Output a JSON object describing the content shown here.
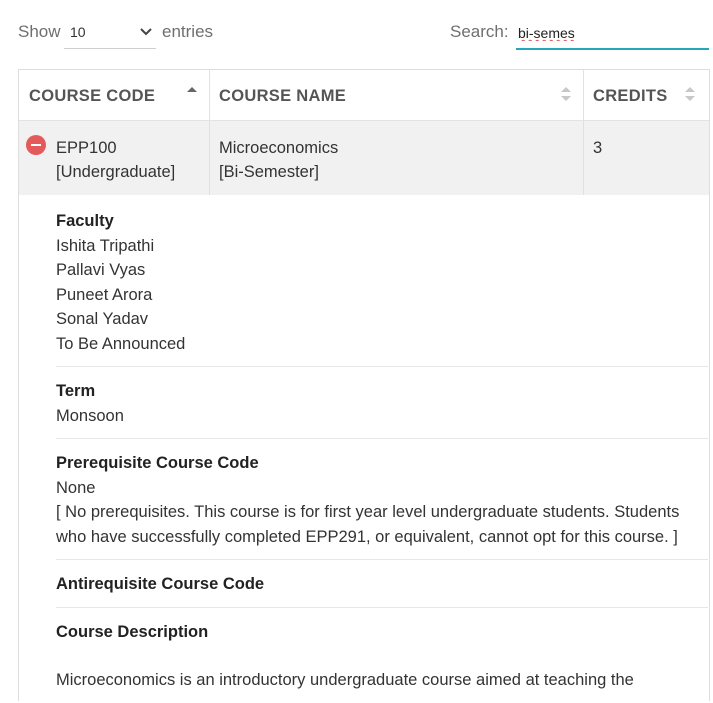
{
  "controls": {
    "show_label": "Show",
    "page_length": "10",
    "entries_label": "entries",
    "search_label": "Search:",
    "search_value": "bi-semes"
  },
  "table": {
    "headers": {
      "course_code": "COURSE CODE",
      "course_name": "COURSE NAME",
      "credits": "CREDITS"
    },
    "row": {
      "code": "EPP100",
      "level": "[Undergraduate]",
      "name": "Microeconomics",
      "term_type": "[Bi-Semester]",
      "credits": "3"
    }
  },
  "details": {
    "faculty_label": "Faculty",
    "faculty": [
      "Ishita Tripathi",
      "Pallavi Vyas",
      "Puneet Arora",
      "Sonal Yadav",
      "To Be Announced"
    ],
    "term_label": "Term",
    "term": "Monsoon",
    "prereq_label": "Prerequisite Course Code",
    "prereq_value": "None",
    "prereq_note": "[ No prerequisites. This course is for first year level undergraduate students. Students who have successfully completed EPP291, or equivalent, cannot opt for this course. ]",
    "antireq_label": "Antirequisite Course Code",
    "description_label": "Course Description",
    "description": "Microeconomics is an introductory undergraduate course aimed at teaching the"
  },
  "colors": {
    "accent": "#27a6b8",
    "remove_button": "#e45a5a",
    "row_background": "#f1f1f1"
  }
}
